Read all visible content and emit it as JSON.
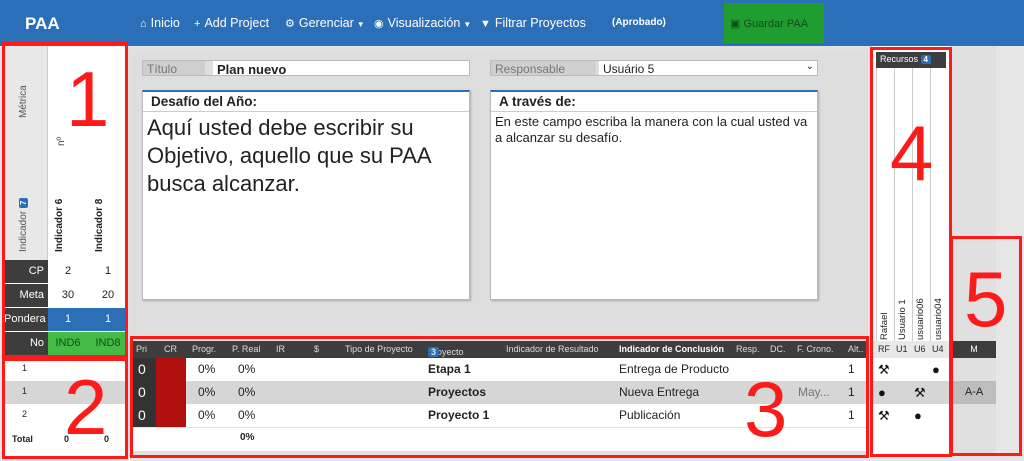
{
  "nav": {
    "brand": "PAA",
    "items": [
      {
        "icon": "home-icon",
        "glyph": "⌂",
        "label": "Inicio"
      },
      {
        "icon": "plus-icon",
        "glyph": "+",
        "label": "Add Project"
      },
      {
        "icon": "gears-icon",
        "glyph": "⚙",
        "label": "Gerenciar"
      },
      {
        "icon": "eye-icon",
        "glyph": "◉",
        "label": "Visualización"
      },
      {
        "icon": "filter-icon",
        "glyph": "▼",
        "label": "Filtrar Proyectos"
      }
    ],
    "status": "(Aprobado)",
    "save_label": "Guardar PAA"
  },
  "form": {
    "titulo_label": "Título",
    "titulo_value": "Plan nuevo",
    "responsable_label": "Responsable",
    "responsable_value": "Usuário 5",
    "desafio_header": "Desafío del Año:",
    "desafio_text": "Aquí usted debe escribir su Objetivo, aquello que su PAA busca alcanzar.",
    "traves_header": "A través de:",
    "traves_text": "En este campo escriba la manera con la cual usted va a alcanzar su desafío."
  },
  "metrics": {
    "metrica_label": "Métrica",
    "n_label": "nº",
    "indicador_label": "Indicador",
    "indicador_count": "7",
    "col1": "Indicador 6",
    "col2": "Indicador 8",
    "rows": [
      {
        "key": "CP",
        "v1": "2",
        "v2": "1"
      },
      {
        "key": "Meta",
        "v1": "30",
        "v2": "20"
      },
      {
        "key": "Pondera",
        "v1": "1",
        "v2": "1"
      },
      {
        "key": "No",
        "v1": "IND6",
        "v2": "IND8"
      }
    ],
    "data_rows": [
      {
        "n": "1",
        "a": "",
        "b": ""
      },
      {
        "n": "1",
        "a": "",
        "b": ""
      },
      {
        "n": "2",
        "a": "",
        "b": ""
      }
    ],
    "total_label": "Total",
    "total_1": "0",
    "total_2": "0"
  },
  "table": {
    "headers": [
      "Pri",
      "CR",
      "Progr.",
      "P. Real",
      "IR",
      "$",
      "Tipo de Proyecto",
      "Proyecto",
      "Indicador de Resultado",
      "Indicador de Conclusión",
      "Resp.",
      "DC.",
      "F. Crono.",
      "Alt.."
    ],
    "proyecto_count": "3",
    "rows": [
      {
        "pri": "0",
        "progr": "0%",
        "preal": "0%",
        "proyecto": "Etapa 1",
        "conclusion": "Entrega de Producto",
        "fcrono": "",
        "alt": "1"
      },
      {
        "pri": "0",
        "progr": "0%",
        "preal": "0%",
        "proyecto": "Proyectos",
        "conclusion": "Nueva Entrega",
        "fcrono": "May...",
        "alt": "1"
      },
      {
        "pri": "0",
        "progr": "0%",
        "preal": "0%",
        "proyecto": "Proyecto 1",
        "conclusion": "Publicación",
        "fcrono": "",
        "alt": "1"
      }
    ],
    "total_preal": "0%"
  },
  "recursos": {
    "label": "Recursos",
    "count": "4",
    "people": [
      "Rafael",
      "Usuario 1",
      "usuario06",
      "usuario04"
    ],
    "abbr": [
      "RF",
      "U1",
      "U6",
      "U4"
    ]
  },
  "mcol": {
    "header": "M",
    "values": [
      "",
      "A-A",
      ""
    ]
  },
  "annotations": [
    "1",
    "2",
    "3",
    "4",
    "5"
  ],
  "colors": {
    "nav": "#2b6fb8",
    "save": "#1f9e2f",
    "cr": "#b10e0e",
    "ponderation": "#2b6fb8",
    "no_row": "#44bb44",
    "annotation": "#ff1a1a"
  }
}
